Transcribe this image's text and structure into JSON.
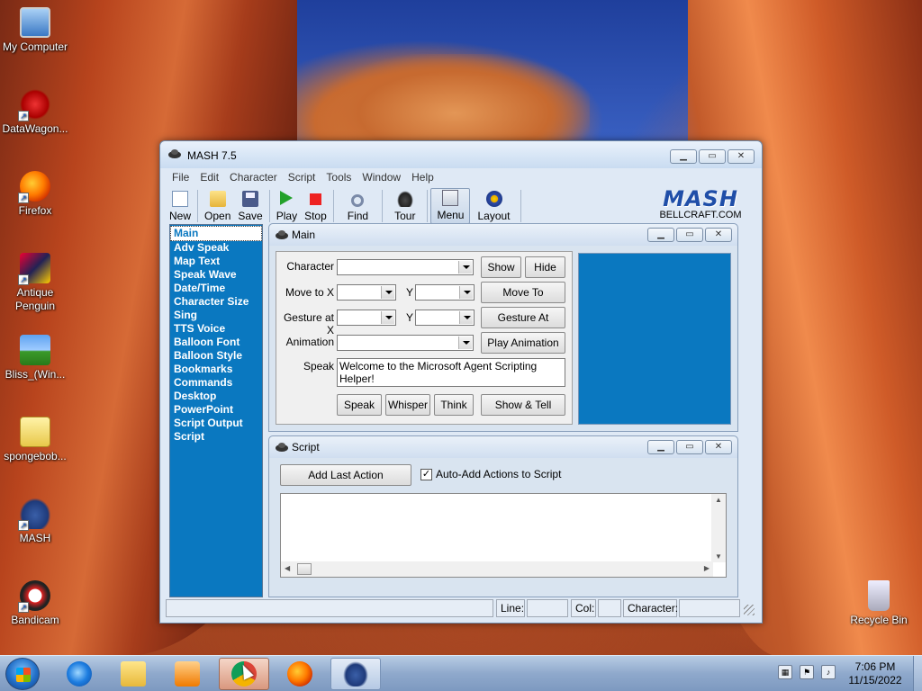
{
  "desktop": {
    "icons": [
      {
        "label": "My Computer",
        "icon": "computer-icon"
      },
      {
        "label": "DataWagon...",
        "icon": "datawagon-icon"
      },
      {
        "label": "Firefox",
        "icon": "firefox-icon"
      },
      {
        "label": "Antique Penguin",
        "icon": "penguin-icon"
      },
      {
        "label": "Bliss_(Win...",
        "icon": "image-file-icon"
      },
      {
        "label": "spongebob...",
        "icon": "zip-file-icon"
      },
      {
        "label": "MASH",
        "icon": "mash-icon"
      },
      {
        "label": "Bandicam",
        "icon": "bandicam-icon"
      },
      {
        "label": "Recycle Bin",
        "icon": "recycle-bin-icon"
      }
    ]
  },
  "window": {
    "title": "MASH 7.5",
    "menu": [
      "File",
      "Edit",
      "Character",
      "Script",
      "Tools",
      "Window",
      "Help"
    ],
    "toolbar": {
      "new": "New",
      "open": "Open",
      "save": "Save",
      "play": "Play",
      "stop": "Stop",
      "find": "Find",
      "tour": "Tour",
      "menu": "Menu",
      "layout": "Layout"
    },
    "brand": {
      "logo": "MASH",
      "url": "BELLCRAFT.COM"
    },
    "nav": {
      "selected": "Main",
      "items": [
        "Main",
        "Adv Speak",
        "Map Text",
        "Speak Wave",
        "Date/Time",
        "Character Size",
        "Sing",
        "TTS Voice",
        "Balloon Font",
        "Balloon Style",
        "Bookmarks",
        "Commands",
        "Desktop",
        "PowerPoint",
        "Script Output",
        "Script"
      ]
    },
    "main_panel": {
      "title": "Main",
      "character_label": "Character",
      "character_value": "",
      "show_button": "Show",
      "hide_button": "Hide",
      "moveto_label": "Move to X",
      "moveto_y_label": "Y",
      "moveto_button": "Move To",
      "gesture_label": "Gesture at X",
      "gesture_y_label": "Y",
      "gesture_button": "Gesture At",
      "animation_label": "Animation",
      "animation_value": "",
      "play_animation_button": "Play Animation",
      "speak_label": "Speak",
      "speak_text": "Welcome to the Microsoft Agent Scripting Helper!",
      "speak_button": "Speak",
      "whisper_button": "Whisper",
      "think_button": "Think",
      "show_tell_button": "Show & Tell"
    },
    "script_panel": {
      "title": "Script",
      "add_last_action_button": "Add Last Action",
      "auto_add_label": "Auto-Add Actions to Script",
      "auto_add_checked": true,
      "script_text": ""
    },
    "statusbar": {
      "line_label": "Line:",
      "line_value": "",
      "col_label": "Col:",
      "col_value": "",
      "character_label": "Character:",
      "character_value": ""
    }
  },
  "taskbar": {
    "apps": [
      "internet-explorer",
      "file-explorer",
      "media-player",
      "chrome",
      "firefox",
      "mash"
    ],
    "active_app": "mash",
    "clock_time": "7:06 PM",
    "clock_date": "11/15/2022"
  }
}
